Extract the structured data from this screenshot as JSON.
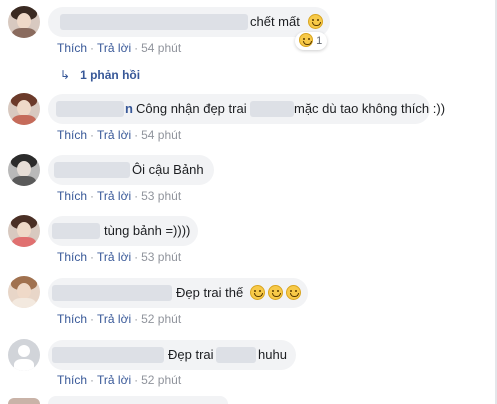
{
  "comments": [
    {
      "text": "chết mất",
      "emoji": "😥",
      "actions": {
        "like": "Thích",
        "reply": "Trả lời",
        "time": "54 phút"
      },
      "reaction": {
        "icon": "laughing-emoji-icon",
        "count": "1"
      },
      "replies_link": {
        "icon": "reply-arrow-icon",
        "label": "1 phản hồi"
      }
    },
    {
      "name_suffix": "n",
      "text_a": "Công nhận đẹp trai",
      "text_b": "mặc dù tao không thích :))",
      "actions": {
        "like": "Thích",
        "reply": "Trả lời",
        "time": "54 phút"
      }
    },
    {
      "text": "Ôi cậu Bảnh",
      "actions": {
        "like": "Thích",
        "reply": "Trả lời",
        "time": "53 phút"
      }
    },
    {
      "text": "tùng bảnh =))))",
      "actions": {
        "like": "Thích",
        "reply": "Trả lời",
        "time": "53 phút"
      }
    },
    {
      "text": "Đẹp trai thế",
      "emoji": "smiling-face-icon x3",
      "actions": {
        "like": "Thích",
        "reply": "Trả lời",
        "time": "52 phút"
      }
    },
    {
      "text_a": "Đẹp trai",
      "text_b": "huhu",
      "actions": {
        "like": "Thích",
        "reply": "Trả lời",
        "time": "52 phút"
      }
    }
  ],
  "colors": {
    "bubble": "#f2f3f5",
    "link": "#385898",
    "meta": "#90949c",
    "blur": "#dde0e6"
  }
}
